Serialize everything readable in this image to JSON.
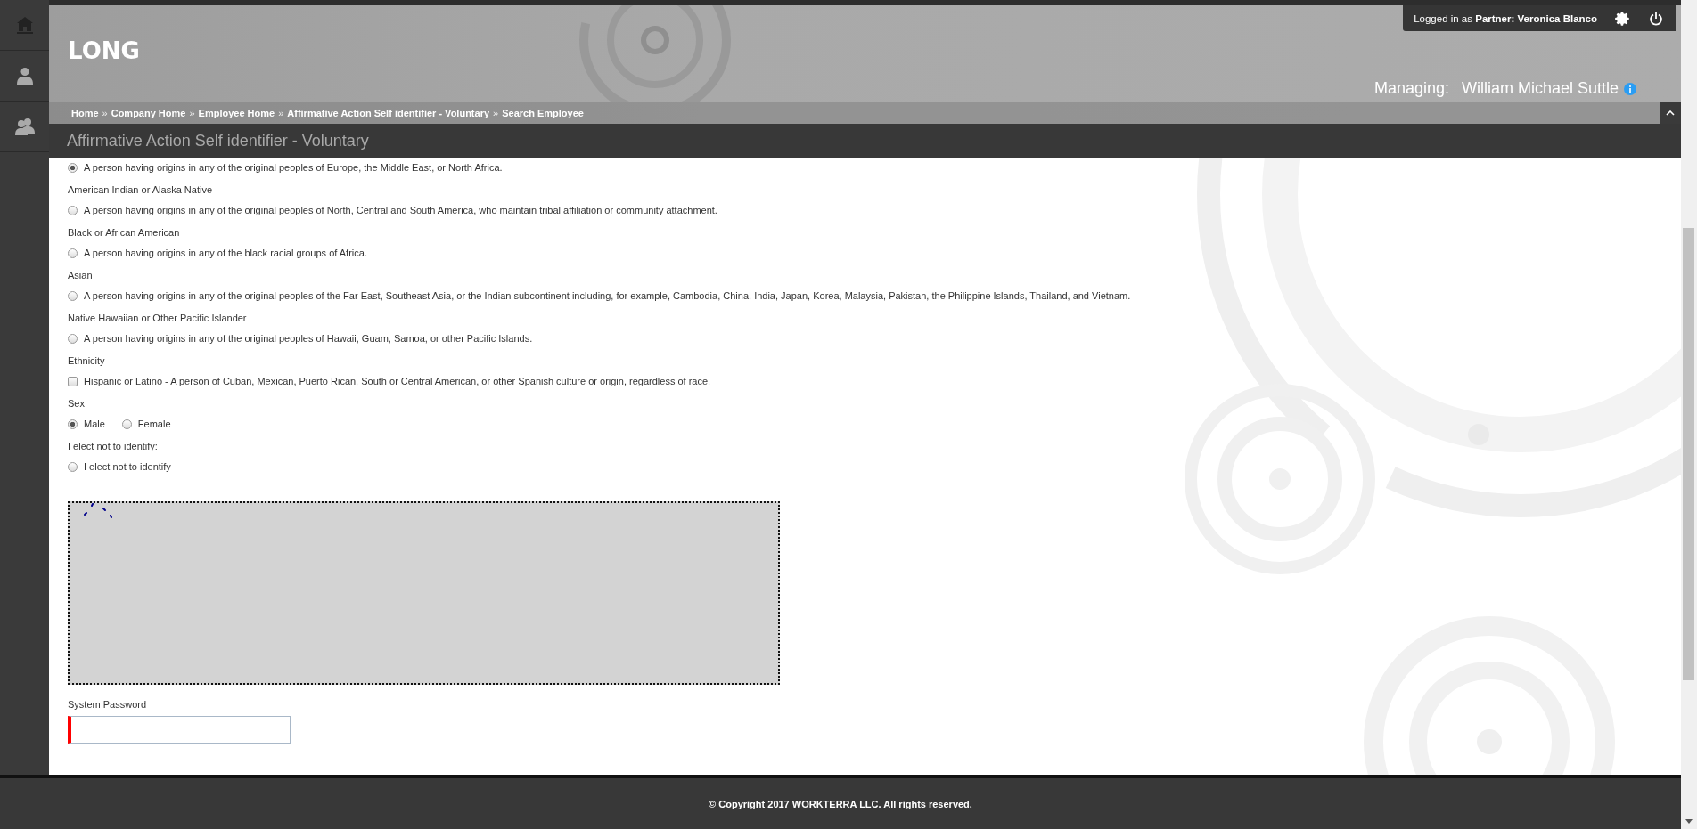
{
  "sidebar": {
    "items": [
      {
        "kind": "home"
      },
      {
        "kind": "person"
      },
      {
        "kind": "people"
      }
    ]
  },
  "header": {
    "logo": "LONG",
    "login": "Logged in as **Partner:  Veronica Blanco**",
    "managing_label": "Managing:",
    "managing_name": "William Michael Suttle"
  },
  "breadcrumbs": {
    "separator": "»",
    "items": [
      "Home",
      "Company Home",
      "Employee Home",
      "Affirmative Action Self identifier - Voluntary",
      "Search Employee"
    ]
  },
  "page_title": "Affirmative Action Self identifier - Voluntary",
  "race_options": [
    {
      "description": "A person having origins in any of the original peoples of Europe, the Middle East, or North Africa.",
      "selected": true
    },
    {
      "label": "American Indian or Alaska Native",
      "description": "A person having origins in any of the original peoples of North, Central and South America, who maintain tribal affiliation or community attachment.",
      "selected": false
    },
    {
      "label": "Black or African American",
      "description": "A person having origins in any of the black racial groups of Africa.",
      "selected": false
    },
    {
      "label": "Asian",
      "description": "A person having origins in any of the original peoples of the Far East, Southeast Asia, or the Indian subcontinent including, for example, Cambodia, China, India, Japan, Korea, Malaysia, Pakistan, the Philippine Islands, Thailand, and Vietnam.",
      "selected": false
    },
    {
      "label": "Native Hawaiian or Other Pacific Islander",
      "description": "A person having origins in any of the original peoples of Hawaii, Guam, Samoa, or other Pacific Islands.",
      "selected": false
    }
  ],
  "ethnicity": {
    "label": "Ethnicity",
    "option": "Hispanic or Latino - A person of Cuban, Mexican, Puerto Rican, South or Central American, or other Spanish culture or origin, regardless of race.",
    "checked": false
  },
  "sex": {
    "label": "Sex",
    "options": [
      {
        "label": "Male",
        "selected": true
      },
      {
        "label": "Female",
        "selected": false
      }
    ]
  },
  "opt_out": {
    "label": "I elect not to identify:",
    "option": "I elect not to identify",
    "selected": false
  },
  "password": {
    "label": "System Password",
    "required": true
  },
  "footer": "© Copyright 2017 WORKTERRA LLC. All rights reserved."
}
